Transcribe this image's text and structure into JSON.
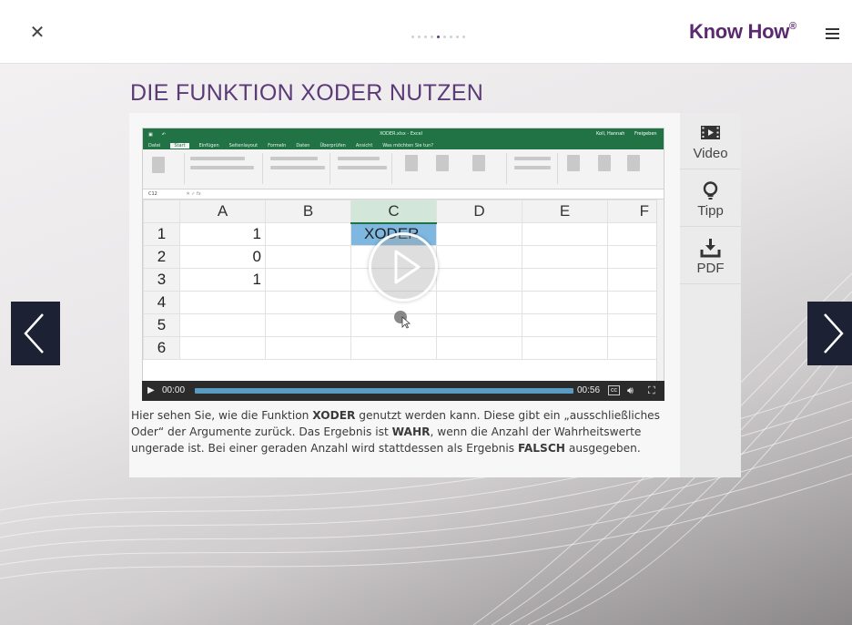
{
  "header": {
    "close_icon": "close-icon",
    "brand": "Know How",
    "brand_mark": "®",
    "menu_icon": "menu-icon",
    "pager": {
      "total": 9,
      "active": 4
    }
  },
  "page_title": "DIE FUNKTION XODER NUTZEN",
  "sidebar": {
    "items": [
      {
        "label": "Video",
        "icon": "video-icon"
      },
      {
        "label": "Tipp",
        "icon": "lightbulb-icon"
      },
      {
        "label": "PDF",
        "icon": "download-icon"
      }
    ]
  },
  "video": {
    "excel": {
      "window_title": "XODER.xlsx - Excel",
      "tabs": [
        "Datei",
        "Start",
        "Einfügen",
        "Seitenlayout",
        "Formeln",
        "Daten",
        "Überprüfen",
        "Ansicht",
        "Was möchten Sie tun?"
      ],
      "active_tab": "Start",
      "user": "Koll, Hannah",
      "share": "Freigeben",
      "name_box": "C12",
      "columns": [
        "A",
        "B",
        "C",
        "D",
        "E",
        "F"
      ],
      "rows": [
        {
          "n": "1",
          "a": "1",
          "c": "XODER"
        },
        {
          "n": "2",
          "a": "0",
          "c": ""
        },
        {
          "n": "3",
          "a": "1",
          "c": ""
        },
        {
          "n": "4",
          "a": "",
          "c": ""
        },
        {
          "n": "5",
          "a": "",
          "c": ""
        },
        {
          "n": "6",
          "a": "",
          "c": ""
        }
      ]
    },
    "controls": {
      "current_time": "00:00",
      "duration": "00:56",
      "progress": 0.0,
      "cc_label": "cc",
      "play_icon": "play-icon",
      "volume_icon": "volume-icon",
      "fullscreen_icon": "fullscreen-icon"
    }
  },
  "description": {
    "p1": "Hier sehen Sie, wie die Funktion ",
    "b1": "XODER",
    "p2": " genutzt werden kann. Diese gibt ein „ausschließliches Oder“ der Argumente zurück. Das Ergebnis ist ",
    "b2": "WAHR",
    "p3": ", wenn die Anzahl der Wahrheitswerte ungerade ist. Bei einer geraden Anzahl wird stattdessen als Ergebnis ",
    "b3": "FALSCH",
    "p4": " ausgegeben."
  },
  "nav": {
    "prev_icon": "chevron-left-icon",
    "next_icon": "chevron-right-icon"
  }
}
